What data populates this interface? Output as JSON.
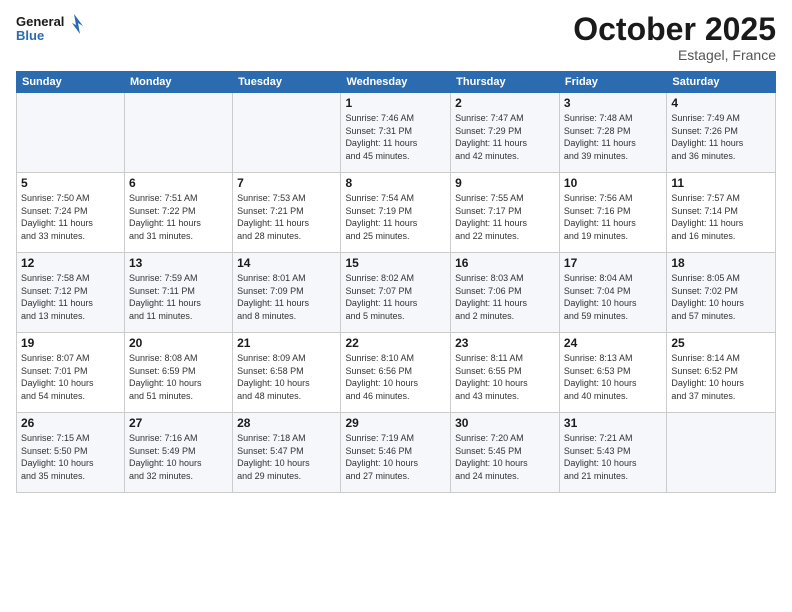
{
  "header": {
    "logo_line1": "General",
    "logo_line2": "Blue",
    "month": "October 2025",
    "location": "Estagel, France"
  },
  "weekdays": [
    "Sunday",
    "Monday",
    "Tuesday",
    "Wednesday",
    "Thursday",
    "Friday",
    "Saturday"
  ],
  "weeks": [
    [
      {
        "day": "",
        "info": ""
      },
      {
        "day": "",
        "info": ""
      },
      {
        "day": "",
        "info": ""
      },
      {
        "day": "1",
        "info": "Sunrise: 7:46 AM\nSunset: 7:31 PM\nDaylight: 11 hours\nand 45 minutes."
      },
      {
        "day": "2",
        "info": "Sunrise: 7:47 AM\nSunset: 7:29 PM\nDaylight: 11 hours\nand 42 minutes."
      },
      {
        "day": "3",
        "info": "Sunrise: 7:48 AM\nSunset: 7:28 PM\nDaylight: 11 hours\nand 39 minutes."
      },
      {
        "day": "4",
        "info": "Sunrise: 7:49 AM\nSunset: 7:26 PM\nDaylight: 11 hours\nand 36 minutes."
      }
    ],
    [
      {
        "day": "5",
        "info": "Sunrise: 7:50 AM\nSunset: 7:24 PM\nDaylight: 11 hours\nand 33 minutes."
      },
      {
        "day": "6",
        "info": "Sunrise: 7:51 AM\nSunset: 7:22 PM\nDaylight: 11 hours\nand 31 minutes."
      },
      {
        "day": "7",
        "info": "Sunrise: 7:53 AM\nSunset: 7:21 PM\nDaylight: 11 hours\nand 28 minutes."
      },
      {
        "day": "8",
        "info": "Sunrise: 7:54 AM\nSunset: 7:19 PM\nDaylight: 11 hours\nand 25 minutes."
      },
      {
        "day": "9",
        "info": "Sunrise: 7:55 AM\nSunset: 7:17 PM\nDaylight: 11 hours\nand 22 minutes."
      },
      {
        "day": "10",
        "info": "Sunrise: 7:56 AM\nSunset: 7:16 PM\nDaylight: 11 hours\nand 19 minutes."
      },
      {
        "day": "11",
        "info": "Sunrise: 7:57 AM\nSunset: 7:14 PM\nDaylight: 11 hours\nand 16 minutes."
      }
    ],
    [
      {
        "day": "12",
        "info": "Sunrise: 7:58 AM\nSunset: 7:12 PM\nDaylight: 11 hours\nand 13 minutes."
      },
      {
        "day": "13",
        "info": "Sunrise: 7:59 AM\nSunset: 7:11 PM\nDaylight: 11 hours\nand 11 minutes."
      },
      {
        "day": "14",
        "info": "Sunrise: 8:01 AM\nSunset: 7:09 PM\nDaylight: 11 hours\nand 8 minutes."
      },
      {
        "day": "15",
        "info": "Sunrise: 8:02 AM\nSunset: 7:07 PM\nDaylight: 11 hours\nand 5 minutes."
      },
      {
        "day": "16",
        "info": "Sunrise: 8:03 AM\nSunset: 7:06 PM\nDaylight: 11 hours\nand 2 minutes."
      },
      {
        "day": "17",
        "info": "Sunrise: 8:04 AM\nSunset: 7:04 PM\nDaylight: 10 hours\nand 59 minutes."
      },
      {
        "day": "18",
        "info": "Sunrise: 8:05 AM\nSunset: 7:02 PM\nDaylight: 10 hours\nand 57 minutes."
      }
    ],
    [
      {
        "day": "19",
        "info": "Sunrise: 8:07 AM\nSunset: 7:01 PM\nDaylight: 10 hours\nand 54 minutes."
      },
      {
        "day": "20",
        "info": "Sunrise: 8:08 AM\nSunset: 6:59 PM\nDaylight: 10 hours\nand 51 minutes."
      },
      {
        "day": "21",
        "info": "Sunrise: 8:09 AM\nSunset: 6:58 PM\nDaylight: 10 hours\nand 48 minutes."
      },
      {
        "day": "22",
        "info": "Sunrise: 8:10 AM\nSunset: 6:56 PM\nDaylight: 10 hours\nand 46 minutes."
      },
      {
        "day": "23",
        "info": "Sunrise: 8:11 AM\nSunset: 6:55 PM\nDaylight: 10 hours\nand 43 minutes."
      },
      {
        "day": "24",
        "info": "Sunrise: 8:13 AM\nSunset: 6:53 PM\nDaylight: 10 hours\nand 40 minutes."
      },
      {
        "day": "25",
        "info": "Sunrise: 8:14 AM\nSunset: 6:52 PM\nDaylight: 10 hours\nand 37 minutes."
      }
    ],
    [
      {
        "day": "26",
        "info": "Sunrise: 7:15 AM\nSunset: 5:50 PM\nDaylight: 10 hours\nand 35 minutes."
      },
      {
        "day": "27",
        "info": "Sunrise: 7:16 AM\nSunset: 5:49 PM\nDaylight: 10 hours\nand 32 minutes."
      },
      {
        "day": "28",
        "info": "Sunrise: 7:18 AM\nSunset: 5:47 PM\nDaylight: 10 hours\nand 29 minutes."
      },
      {
        "day": "29",
        "info": "Sunrise: 7:19 AM\nSunset: 5:46 PM\nDaylight: 10 hours\nand 27 minutes."
      },
      {
        "day": "30",
        "info": "Sunrise: 7:20 AM\nSunset: 5:45 PM\nDaylight: 10 hours\nand 24 minutes."
      },
      {
        "day": "31",
        "info": "Sunrise: 7:21 AM\nSunset: 5:43 PM\nDaylight: 10 hours\nand 21 minutes."
      },
      {
        "day": "",
        "info": ""
      }
    ]
  ]
}
